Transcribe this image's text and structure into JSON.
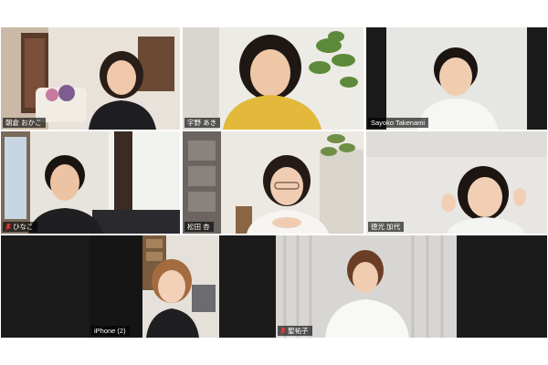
{
  "meeting": {
    "view": "gallery",
    "tiles": [
      {
        "id": "t1",
        "name": "朝倉 おかこ",
        "muted": false,
        "speaking": false
      },
      {
        "id": "t2",
        "name": "宇野 あき",
        "muted": false,
        "speaking": false
      },
      {
        "id": "t3",
        "name": "Sayoko Takenami",
        "muted": false,
        "speaking": true
      },
      {
        "id": "t4",
        "name": "ひなこ",
        "muted": true,
        "speaking": false
      },
      {
        "id": "t5",
        "name": "松田 杏",
        "muted": false,
        "speaking": false
      },
      {
        "id": "t6",
        "name": "徳光 加代",
        "muted": false,
        "speaking": false
      },
      {
        "id": "t7",
        "name": "iPhone (2)",
        "muted": false,
        "speaking": false
      },
      {
        "id": "t8",
        "name": "聖祐子",
        "muted": true,
        "speaking": false
      }
    ]
  },
  "colors": {
    "active_speaker_border": "#c8e64b",
    "tile_background": "#1c1c1c",
    "muted_icon": "#e03b3b"
  }
}
